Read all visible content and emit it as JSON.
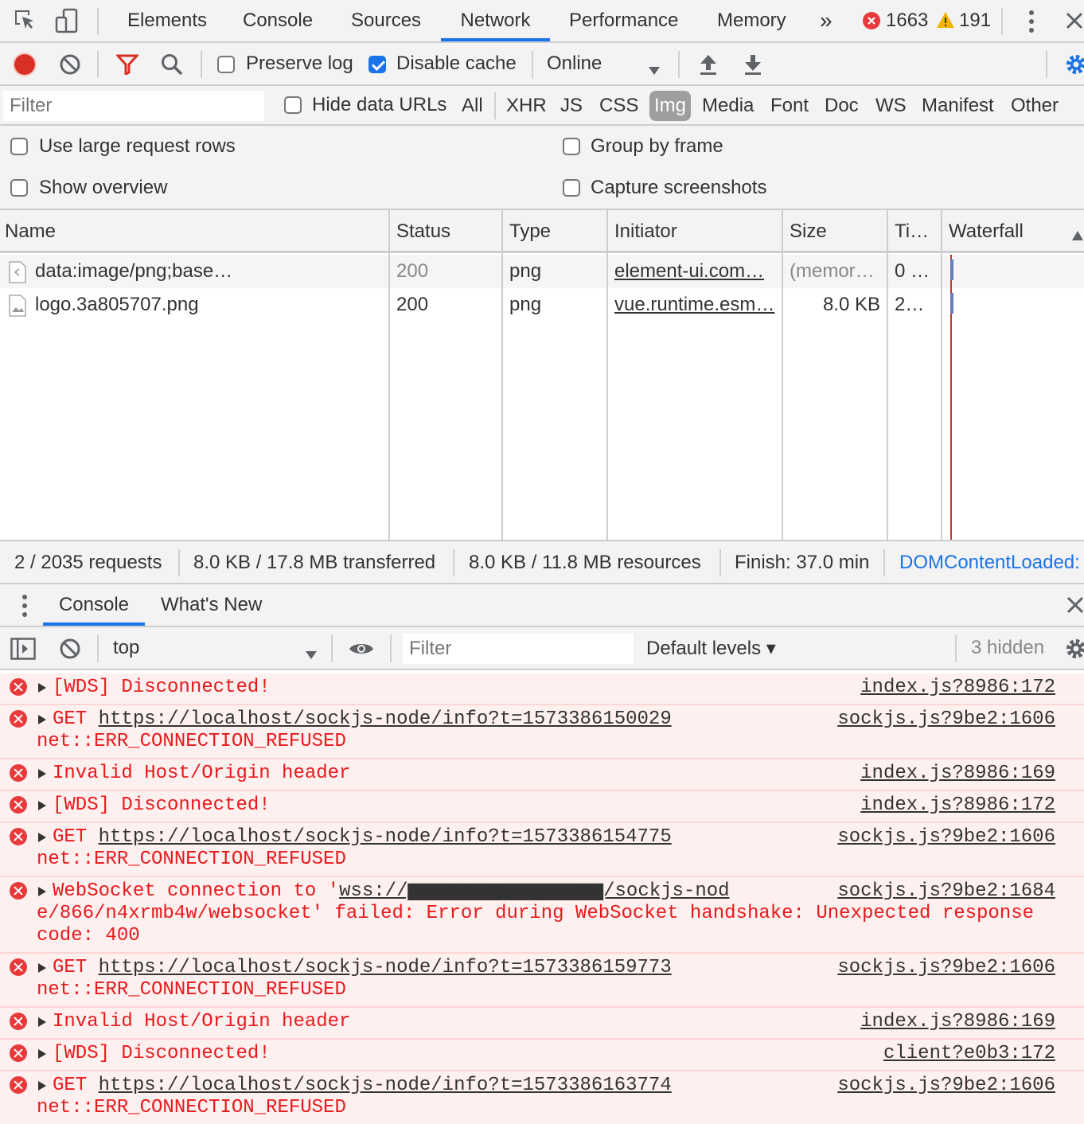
{
  "main_tabs": [
    "Elements",
    "Console",
    "Sources",
    "Network",
    "Performance",
    "Memory"
  ],
  "more_tabs": "»",
  "error_count": "1663",
  "warning_count": "191",
  "toolbar": {
    "preserve_log": "Preserve log",
    "disable_cache": "Disable cache",
    "throttle": "Online"
  },
  "filter": {
    "placeholder": "Filter",
    "hide_data_urls": "Hide data URLs",
    "types": [
      "All",
      "XHR",
      "JS",
      "CSS",
      "Img",
      "Media",
      "Font",
      "Doc",
      "WS",
      "Manifest",
      "Other"
    ],
    "selected_type": "Img"
  },
  "settings": {
    "large_rows": "Use large request rows",
    "group_by_frame": "Group by frame",
    "show_overview": "Show overview",
    "capture_screenshots": "Capture screenshots"
  },
  "table": {
    "headers": [
      "Name",
      "Status",
      "Type",
      "Initiator",
      "Size",
      "Ti…",
      "Waterfall"
    ],
    "rows": [
      {
        "name": "data:image/png;base…",
        "status": "200",
        "type": "png",
        "initiator": "element-ui.com…",
        "size": "(memor…",
        "time": "0 …"
      },
      {
        "name": "logo.3a805707.png",
        "status": "200",
        "type": "png",
        "initiator": "vue.runtime.esm…",
        "size": "8.0 KB",
        "time": "2…"
      }
    ]
  },
  "status_bar": {
    "requests": "2 / 2035 requests",
    "transferred": "8.0 KB / 17.8 MB transferred",
    "resources": "8.0 KB / 11.8 MB resources",
    "finish": "Finish: 37.0 min",
    "dcl": "DOMContentLoaded:"
  },
  "drawer_tabs": [
    "Console",
    "What's New"
  ],
  "console_toolbar": {
    "context": "top",
    "filter_placeholder": "Filter",
    "levels": "Default levels ▾",
    "hidden": "3 hidden"
  },
  "messages": [
    {
      "prefix": "",
      "url": "",
      "suffix": "[WDS] Disconnected!",
      "lines": [],
      "source": "index.js?8986:172"
    },
    {
      "prefix": "GET ",
      "url": "https://localhost/sockjs-node/info?t=1573386150029",
      "suffix": "",
      "lines": [
        "net::ERR_CONNECTION_REFUSED"
      ],
      "source": "sockjs.js?9be2:1606"
    },
    {
      "prefix": "",
      "url": "",
      "suffix": "Invalid Host/Origin header",
      "lines": [],
      "source": "index.js?8986:169"
    },
    {
      "prefix": "",
      "url": "",
      "suffix": "[WDS] Disconnected!",
      "lines": [],
      "source": "index.js?8986:172"
    },
    {
      "prefix": "GET ",
      "url": "https://localhost/sockjs-node/info?t=1573386154775",
      "suffix": "",
      "lines": [
        "net::ERR_CONNECTION_REFUSED"
      ],
      "source": "sockjs.js?9be2:1606"
    },
    {
      "prefix": "WebSocket connection to '",
      "url": "wss://▆▆▆▆▆▆▆▆▆▆▆▆▆▆▆▆▆/sockjs-nod",
      "suffix": "",
      "lines": [
        "e/866/n4xrmb4w/websocket' failed: Error during WebSocket handshake: Unexpected response",
        "code: 400"
      ],
      "source": "sockjs.js?9be2:1684"
    },
    {
      "prefix": "GET ",
      "url": "https://localhost/sockjs-node/info?t=1573386159773",
      "suffix": "",
      "lines": [
        "net::ERR_CONNECTION_REFUSED"
      ],
      "source": "sockjs.js?9be2:1606"
    },
    {
      "prefix": "",
      "url": "",
      "suffix": "Invalid Host/Origin header",
      "lines": [],
      "source": "index.js?8986:169"
    },
    {
      "prefix": "",
      "url": "",
      "suffix": "[WDS] Disconnected!",
      "lines": [],
      "source": "client?e0b3:172"
    },
    {
      "prefix": "GET ",
      "url": "https://localhost/sockjs-node/info?t=1573386163774",
      "suffix": "",
      "lines": [
        "net::ERR_CONNECTION_REFUSED"
      ],
      "source": "sockjs.js?9be2:1606"
    }
  ],
  "colors": {
    "accent": "#1a73e8",
    "error": "#e8191c",
    "error_bg": "#fff0f0",
    "warning": "#f4b400",
    "record": "#d93025"
  }
}
